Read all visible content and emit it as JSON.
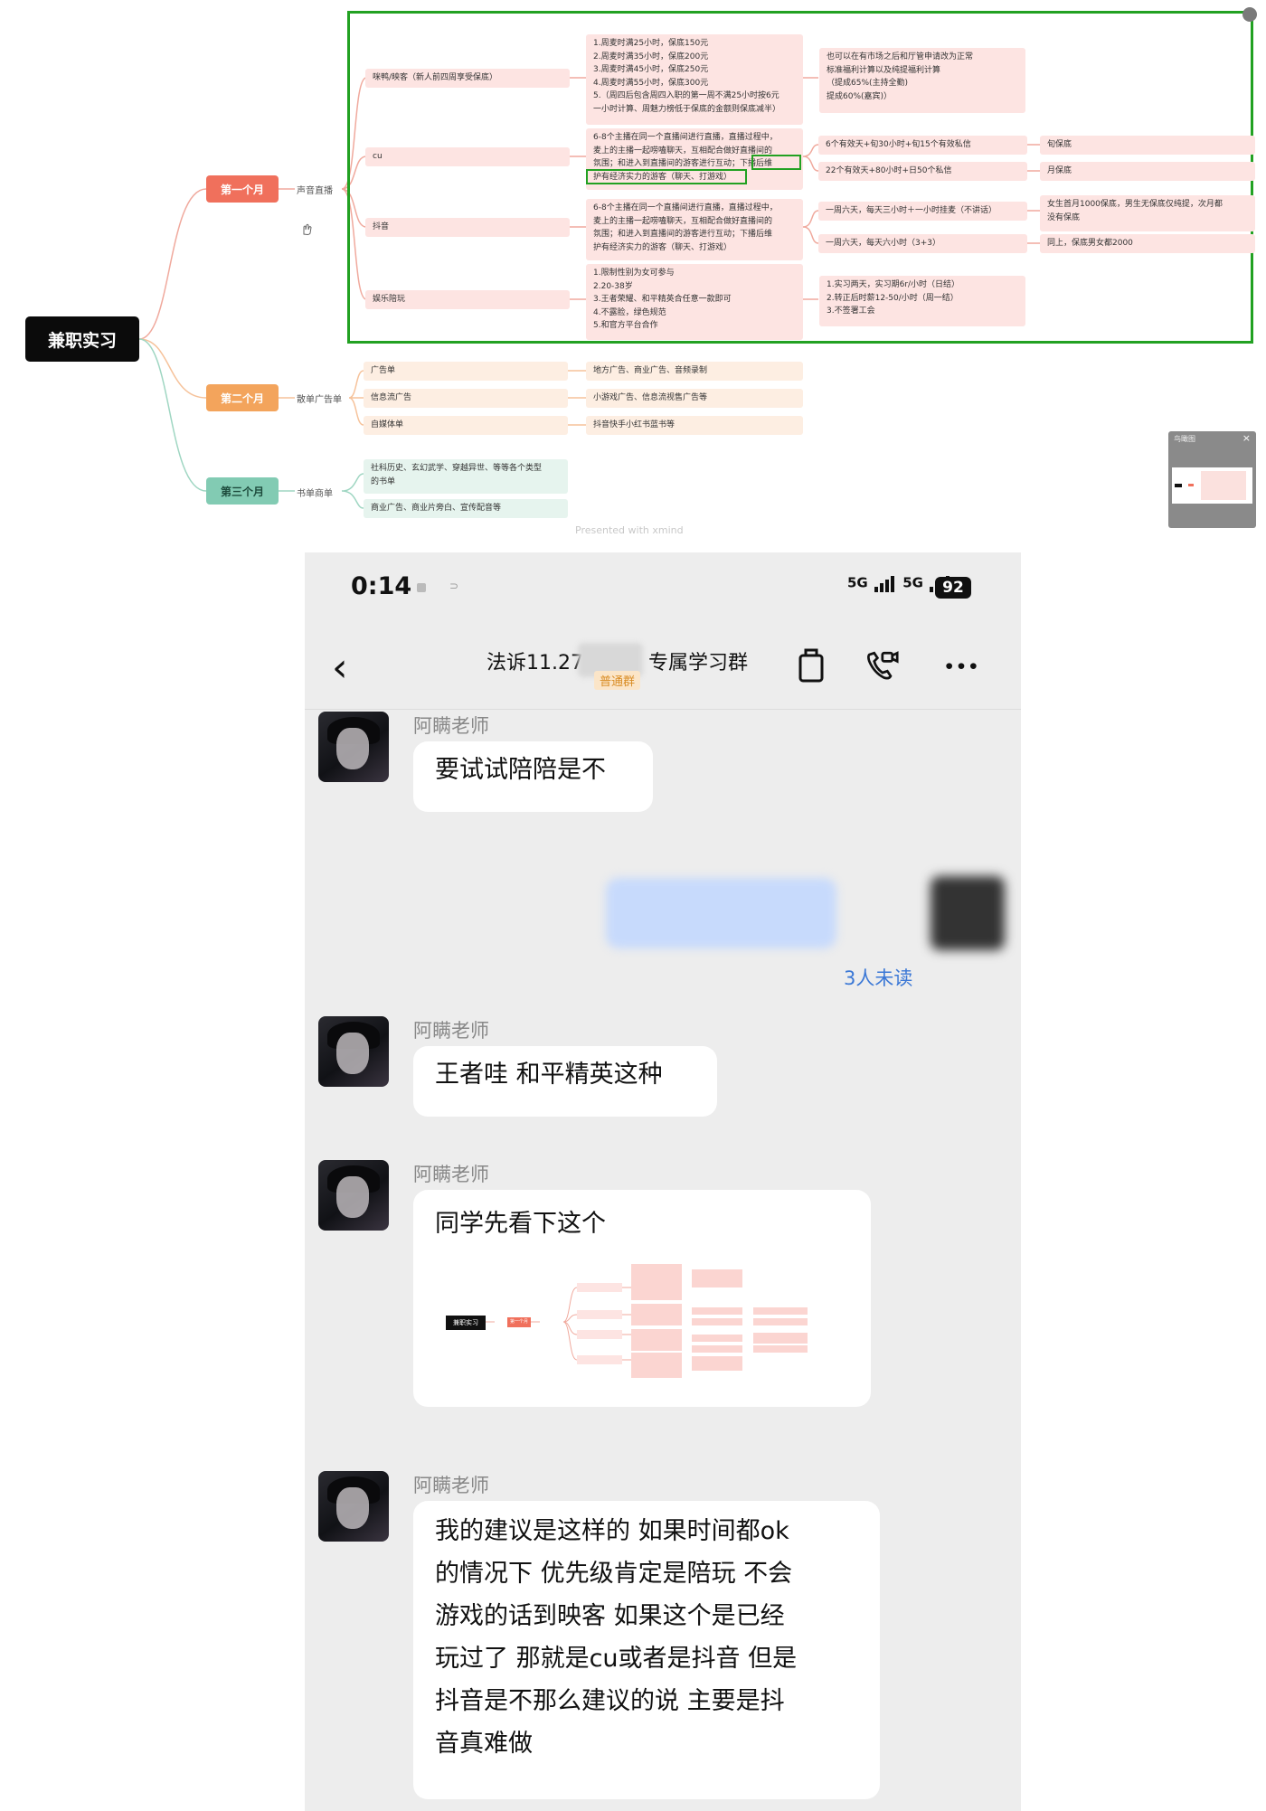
{
  "mindmap": {
    "root": "兼职实习",
    "months": [
      "第一个月",
      "第二个月",
      "第三个月"
    ],
    "month1": {
      "category": "声音直播",
      "branches": [
        {
          "name": "咪鸭/映客（新人前四周享受保底）",
          "detail": [
            "1.周麦时满25小时，保底150元",
            "2.周麦时满35小时，保底200元",
            "3.周麦时满45小时，保底250元",
            "4.周麦时满55小时，保底300元",
            "5.（周四后包含周四入职的第一周不满25小时按6元",
            "一小时计算、周魅力榜低于保底的金额则保底减半）"
          ],
          "note": [
            "也可以在有市场之后和厅管申请改为正常",
            "标准福利计算以及纯提福利计算",
            "（提成65%(主持全勤)",
            "提成60%(嘉宾)）"
          ]
        },
        {
          "name": "cu",
          "detail": [
            "6-8个主播在同一个直播间进行直播，直播过程中，",
            "麦上的主播一起唠嗑聊天，互相配合做好直播间的",
            "氛围；和进入到直播间的游客进行互动；下播后维",
            "护有经济实力的游客（聊天、打游戏）"
          ],
          "subs": [
            [
              "6个有效天+旬30小时+旬15个有效私信",
              "旬保底"
            ],
            [
              "22个有效天+80小时+日50个私信",
              "月保底"
            ]
          ]
        },
        {
          "name": "抖音",
          "detail": [
            "6-8个主播在同一个直播间进行直播，直播过程中，",
            "麦上的主播一起唠嗑聊天，互相配合做好直播间的",
            "氛围；和进入到直播间的游客进行互动；下播后维",
            "护有经济实力的游客（聊天、打游戏）"
          ],
          "subs": [
            [
              "一周六天，每天三小时＋一小时挂麦（不讲话）",
              "女生首月1000保底，男生无保底仅纯提，次月都",
              "没有保底"
            ],
            [
              "一周六天，每天六小时（3+3）",
              "同上，保底男女都2000"
            ]
          ]
        },
        {
          "name": "娱乐陪玩",
          "detail": [
            "1.限制性别为女可参与",
            "2.20-38岁",
            "3.王者荣耀、和平精英合任意一款即可",
            "4.不露脸，绿色规范",
            "5.和官方平台合作"
          ],
          "note": [
            "1.实习两天，实习期6r/小时（日结）",
            "2.转正后时薪12-50/小时（周一结）",
            "3.不签署工会"
          ]
        }
      ],
      "highlight": "下播后维"
    },
    "month2": {
      "category": "散单广告单",
      "items": [
        [
          "广告单",
          "地方广告、商业广告、音频录制"
        ],
        [
          "信息流广告",
          "小游戏广告、信息流视售广告等"
        ],
        [
          "自媒体单",
          "抖音快手小红书蓝书等"
        ]
      ]
    },
    "month3": {
      "category": "书单商单",
      "items": [
        [
          "社科历史、玄幻武学、穿越异世、等等各个类型",
          "的书单"
        ],
        [
          "商业广告、商业片旁白、宣传配音等"
        ]
      ]
    },
    "watermark": "Presented with xmind",
    "thumb_title": "鸟瞰图",
    "thumb_close": "×"
  },
  "phone": {
    "time": "0:14",
    "signal": "5G",
    "battery": "92",
    "title_left": "法诉11.27",
    "title_right": "专属学习群",
    "tag": "普通群",
    "messages": [
      {
        "sender": "阿瞒老师",
        "text": "要试试陪陪是不"
      },
      {
        "sender": "阿瞒老师",
        "text": "王者哇 和平精英这种"
      },
      {
        "sender": "阿瞒老师",
        "text": "同学先看下这个"
      },
      {
        "sender": "阿瞒老师",
        "lines": [
          "我的建议是这样的 如果时间都ok",
          "的情况下 优先级肯定是陪玩 不会",
          "游戏的话到映客 如果这个是已经",
          "玩过了 那就是cu或者是抖音 但是",
          "抖音是不那么建议的说 主要是抖",
          "音真难做"
        ]
      }
    ],
    "unread": "3人未读",
    "mini_root": "兼职实习",
    "mini_month": "第一个月"
  },
  "colors": {
    "month1": "#f0705c",
    "month2": "#f3a45c",
    "month3": "#82cbb3",
    "frame": "#22a122",
    "unread": "#3b78d6"
  }
}
